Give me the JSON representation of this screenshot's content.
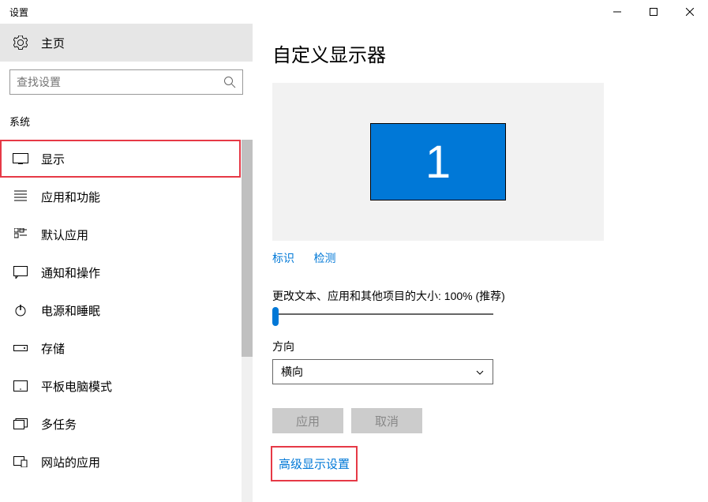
{
  "window": {
    "title": "设置"
  },
  "sidebar": {
    "home": {
      "label": "主页"
    },
    "search": {
      "placeholder": "查找设置"
    },
    "section_label": "系统",
    "items": [
      {
        "label": "显示",
        "icon": "display-icon",
        "highlighted": true
      },
      {
        "label": "应用和功能",
        "icon": "apps-icon"
      },
      {
        "label": "默认应用",
        "icon": "defaults-icon"
      },
      {
        "label": "通知和操作",
        "icon": "notifications-icon"
      },
      {
        "label": "电源和睡眠",
        "icon": "power-icon"
      },
      {
        "label": "存储",
        "icon": "storage-icon"
      },
      {
        "label": "平板电脑模式",
        "icon": "tablet-icon"
      },
      {
        "label": "多任务",
        "icon": "multitask-icon"
      },
      {
        "label": "网站的应用",
        "icon": "website-icon"
      }
    ]
  },
  "main": {
    "title": "自定义显示器",
    "monitor_number": "1",
    "links": {
      "identify": "标识",
      "detect": "检测"
    },
    "scale_label": "更改文本、应用和其他项目的大小: 100% (推荐)",
    "orientation_label": "方向",
    "orientation_value": "横向",
    "buttons": {
      "apply": "应用",
      "cancel": "取消"
    },
    "advanced_link": "高级显示设置"
  }
}
